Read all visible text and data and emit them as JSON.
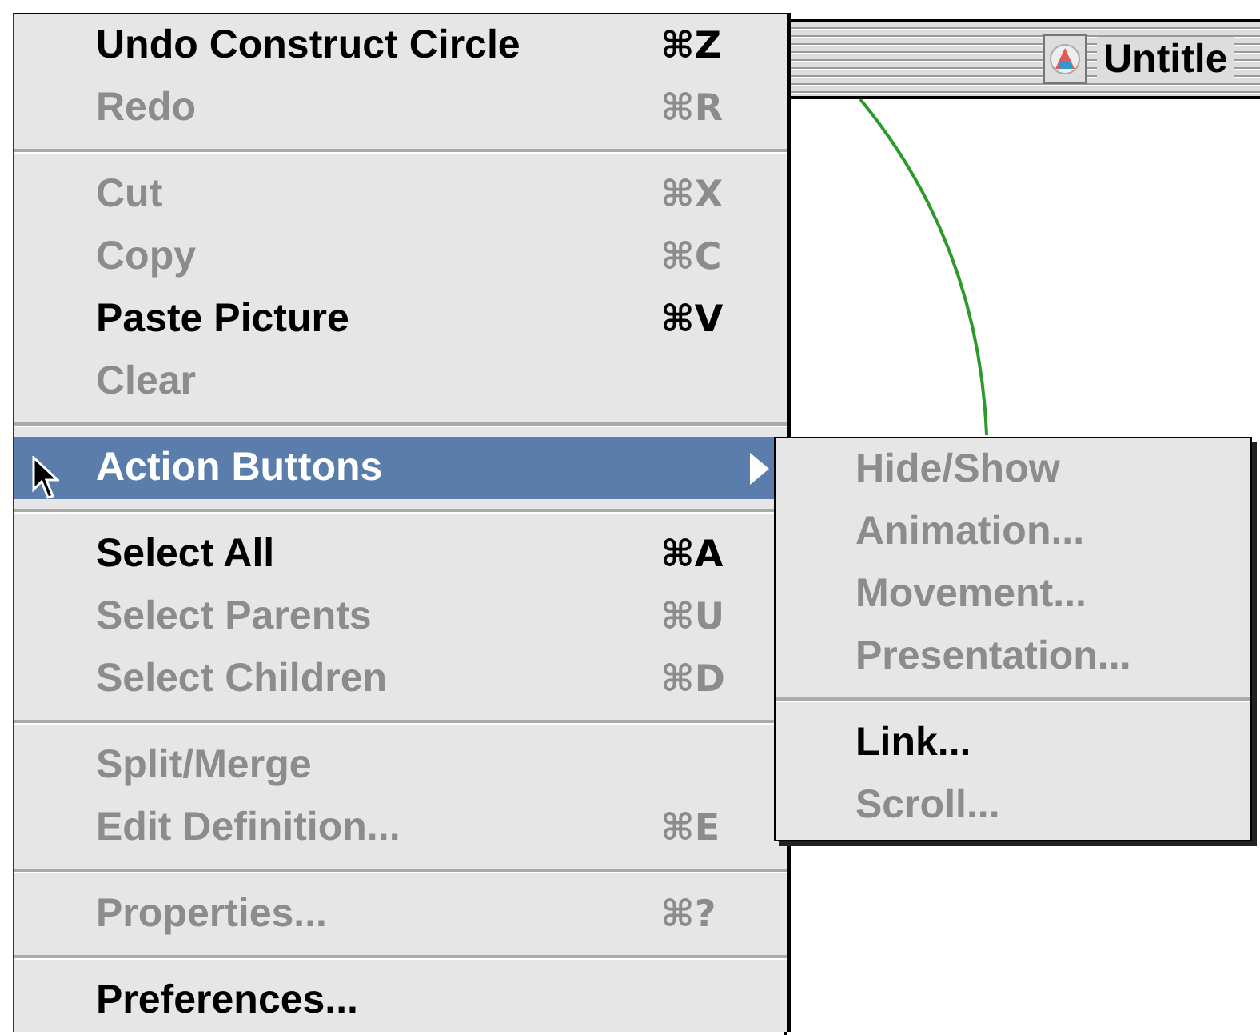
{
  "window": {
    "title": "Untitle"
  },
  "menu": {
    "items": [
      {
        "kind": "item",
        "label": "Undo Construct Circle",
        "shortcut": "⌘Z",
        "disabled": false,
        "selected": false
      },
      {
        "kind": "item",
        "label": "Redo",
        "shortcut": "⌘R",
        "disabled": true,
        "selected": false
      },
      {
        "kind": "separator"
      },
      {
        "kind": "item",
        "label": "Cut",
        "shortcut": "⌘X",
        "disabled": true,
        "selected": false
      },
      {
        "kind": "item",
        "label": "Copy",
        "shortcut": "⌘C",
        "disabled": true,
        "selected": false
      },
      {
        "kind": "item",
        "label": "Paste Picture",
        "shortcut": "⌘V",
        "disabled": false,
        "selected": false
      },
      {
        "kind": "item",
        "label": "Clear",
        "disabled": true,
        "selected": false
      },
      {
        "kind": "separator"
      },
      {
        "kind": "submenu",
        "label": "Action Buttons",
        "disabled": false,
        "selected": true
      },
      {
        "kind": "separator"
      },
      {
        "kind": "item",
        "label": "Select All",
        "shortcut": "⌘A",
        "disabled": false,
        "selected": false
      },
      {
        "kind": "item",
        "label": "Select Parents",
        "shortcut": "⌘U",
        "disabled": true,
        "selected": false
      },
      {
        "kind": "item",
        "label": "Select Children",
        "shortcut": "⌘D",
        "disabled": true,
        "selected": false
      },
      {
        "kind": "separator"
      },
      {
        "kind": "item",
        "label": "Split/Merge",
        "disabled": true,
        "selected": false
      },
      {
        "kind": "item",
        "label": "Edit Definition...",
        "shortcut": "⌘E",
        "disabled": true,
        "selected": false
      },
      {
        "kind": "separator"
      },
      {
        "kind": "item",
        "label": "Properties...",
        "shortcut": "⌘?",
        "disabled": true,
        "selected": false
      },
      {
        "kind": "separator"
      },
      {
        "kind": "item",
        "label": "Preferences...",
        "disabled": false,
        "selected": false
      }
    ]
  },
  "submenu": {
    "items": [
      {
        "kind": "item",
        "label": "Hide/Show",
        "disabled": true,
        "selected": false
      },
      {
        "kind": "item",
        "label": "Animation...",
        "disabled": true,
        "selected": false
      },
      {
        "kind": "item",
        "label": "Movement...",
        "disabled": true,
        "selected": false
      },
      {
        "kind": "item",
        "label": "Presentation...",
        "disabled": true,
        "selected": false
      },
      {
        "kind": "separator"
      },
      {
        "kind": "item",
        "label": "Link...",
        "disabled": false,
        "selected": false
      },
      {
        "kind": "item",
        "label": "Scroll...",
        "disabled": true,
        "selected": false
      }
    ]
  }
}
